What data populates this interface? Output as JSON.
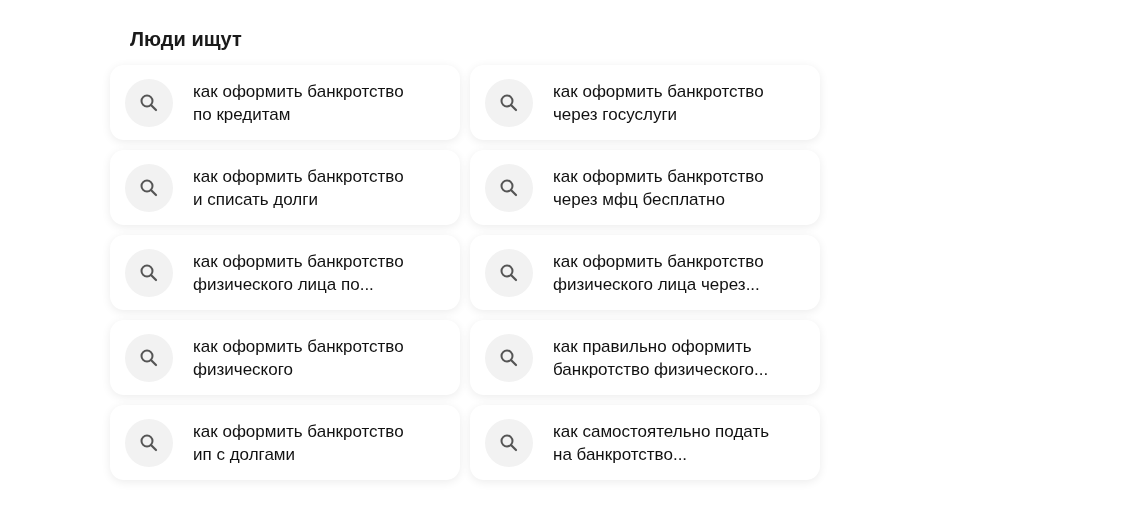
{
  "title": "Люди ищут",
  "suggestions": [
    {
      "text": "как оформить банкротство\nпо кредитам"
    },
    {
      "text": "как оформить банкротство\nчерез госуслуги"
    },
    {
      "text": "как оформить банкротство\nи списать долги"
    },
    {
      "text": "как оформить банкротство\nчерез мфц бесплатно"
    },
    {
      "text": "как оформить банкротство\nфизического лица по..."
    },
    {
      "text": "как оформить банкротство\nфизического лица через..."
    },
    {
      "text": "как оформить банкротство\nфизического"
    },
    {
      "text": "как правильно оформить\nбанкротство физического..."
    },
    {
      "text": "как оформить банкротство\nип с долгами"
    },
    {
      "text": "как самостоятельно подать\nна банкротство..."
    }
  ]
}
